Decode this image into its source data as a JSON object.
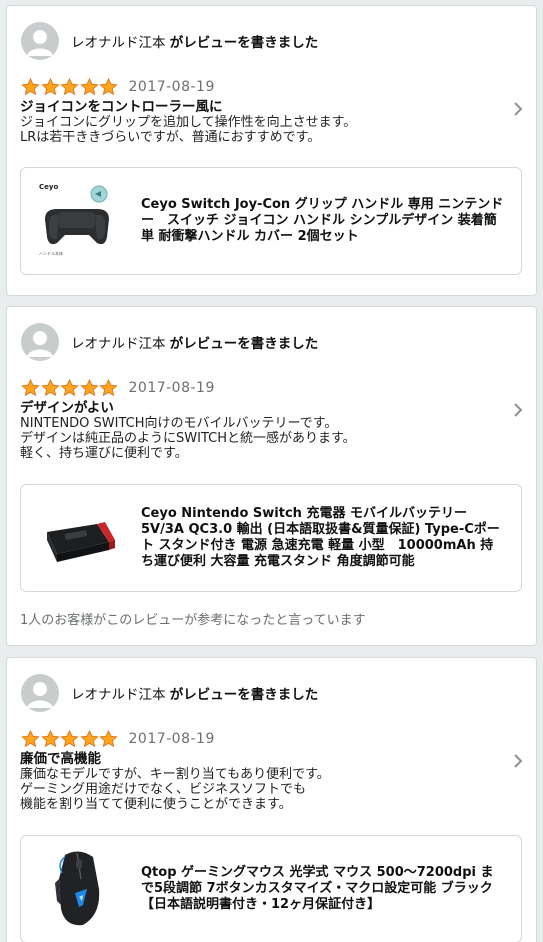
{
  "reviews": [
    {
      "reviewer": "レオナルド江本",
      "action": "がレビューを書きました",
      "stars": 5,
      "date": "2017-08-19",
      "title": "ジョイコンをコントローラー風に",
      "body": "ジョイコンにグリップを追加して操作性を向上させます。\nLRは若干ききづらいですが、普通におすすめです。",
      "product_title": "Ceyo Switch Joy-Con グリップ ハンドル 専用 ニンテンドー　スイッチ ジョイコン ハンドル シンプルデザイン 装着簡単 耐衝撃ハンドル カバー 2個セット",
      "product_brand_text": "Ceyo",
      "product_image_icon": "controller-grip-image",
      "helpful": ""
    },
    {
      "reviewer": "レオナルド江本",
      "action": "がレビューを書きました",
      "stars": 5,
      "date": "2017-08-19",
      "title": "デザインがよい",
      "body": "NINTENDO SWITCH向けのモバイルバッテリーです。\nデザインは純正品のようにSWITCHと統一感があります。\n軽く、持ち運びに便利です。",
      "product_title": "Ceyo Nintendo Switch 充電器 モバイルバッテリー 5V/3A QC3.0 輸出 (日本語取扱書&質量保証) Type-Cポート スタンド付き 電源 急速充電 軽量 小型　10000mAh 持ち運び便利 大容量 充電スタンド 角度調節可能",
      "product_image_icon": "battery-stand-image",
      "helpful": "1人のお客様がこのレビューが参考になったと言っています"
    },
    {
      "reviewer": "レオナルド江本",
      "action": "がレビューを書きました",
      "stars": 5,
      "date": "2017-08-19",
      "title": "廉価で高機能",
      "body": "廉価なモデルですが、キー割り当てもあり便利です。\nゲーミング用途だけでなく、ビジネスソフトでも\n機能を割り当てて便利に使うことができます。",
      "product_title": "Qtop ゲーミングマウス 光学式 マウス 500〜7200dpi まで5段調節 7ボタンカスタマイズ・マクロ設定可能 ブラック 【日本語説明書付き・12ヶ月保証付き】",
      "product_image_icon": "gaming-mouse-image",
      "helpful": ""
    }
  ],
  "colors": {
    "star": "#ffa41c",
    "star_stroke": "#de7921",
    "border": "#d5d9d9",
    "bg": "#eaeded"
  },
  "icons": {
    "avatar": "person-avatar-icon",
    "star": "star-icon",
    "chevron": "chevron-right-icon"
  }
}
